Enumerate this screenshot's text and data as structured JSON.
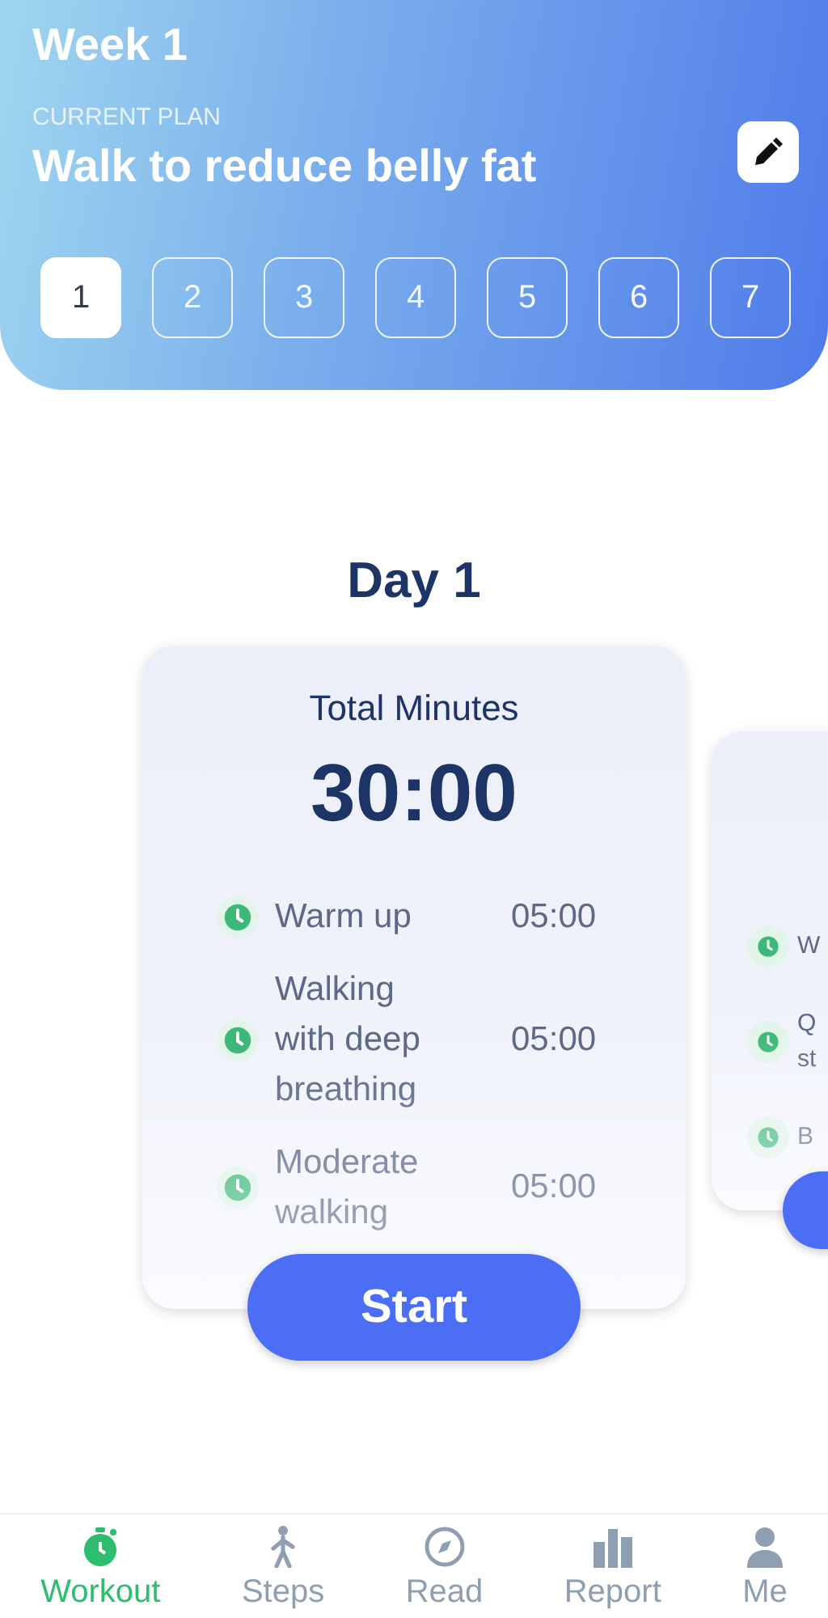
{
  "header": {
    "title": "Week 1",
    "plan_label": "CURRENT PLAN",
    "plan_name": "Walk to reduce belly fat",
    "days": [
      {
        "label": "1",
        "selected": true
      },
      {
        "label": "2",
        "selected": false
      },
      {
        "label": "3",
        "selected": false
      },
      {
        "label": "4",
        "selected": false
      },
      {
        "label": "5",
        "selected": false
      },
      {
        "label": "6",
        "selected": false
      },
      {
        "label": "7",
        "selected": false
      }
    ]
  },
  "day_title": "Day 1",
  "cards": [
    {
      "kind": "full",
      "total_label": "Total Minutes",
      "total": "30:00",
      "button": "Start",
      "items": [
        {
          "label": "Warm up",
          "time": "05:00"
        },
        {
          "label": "Walking with deep breathing",
          "time": "05:00"
        },
        {
          "label": "Moderate walking",
          "time": "05:00"
        }
      ]
    },
    {
      "kind": "peek",
      "items": [
        {
          "label": "W"
        },
        {
          "label": "Q st"
        },
        {
          "label": "B"
        }
      ]
    }
  ],
  "nav": [
    {
      "label": "Workout",
      "selected": true
    },
    {
      "label": "Steps",
      "selected": false
    },
    {
      "label": "Read",
      "selected": false
    },
    {
      "label": "Report",
      "selected": false
    },
    {
      "label": "Me",
      "selected": false
    }
  ]
}
